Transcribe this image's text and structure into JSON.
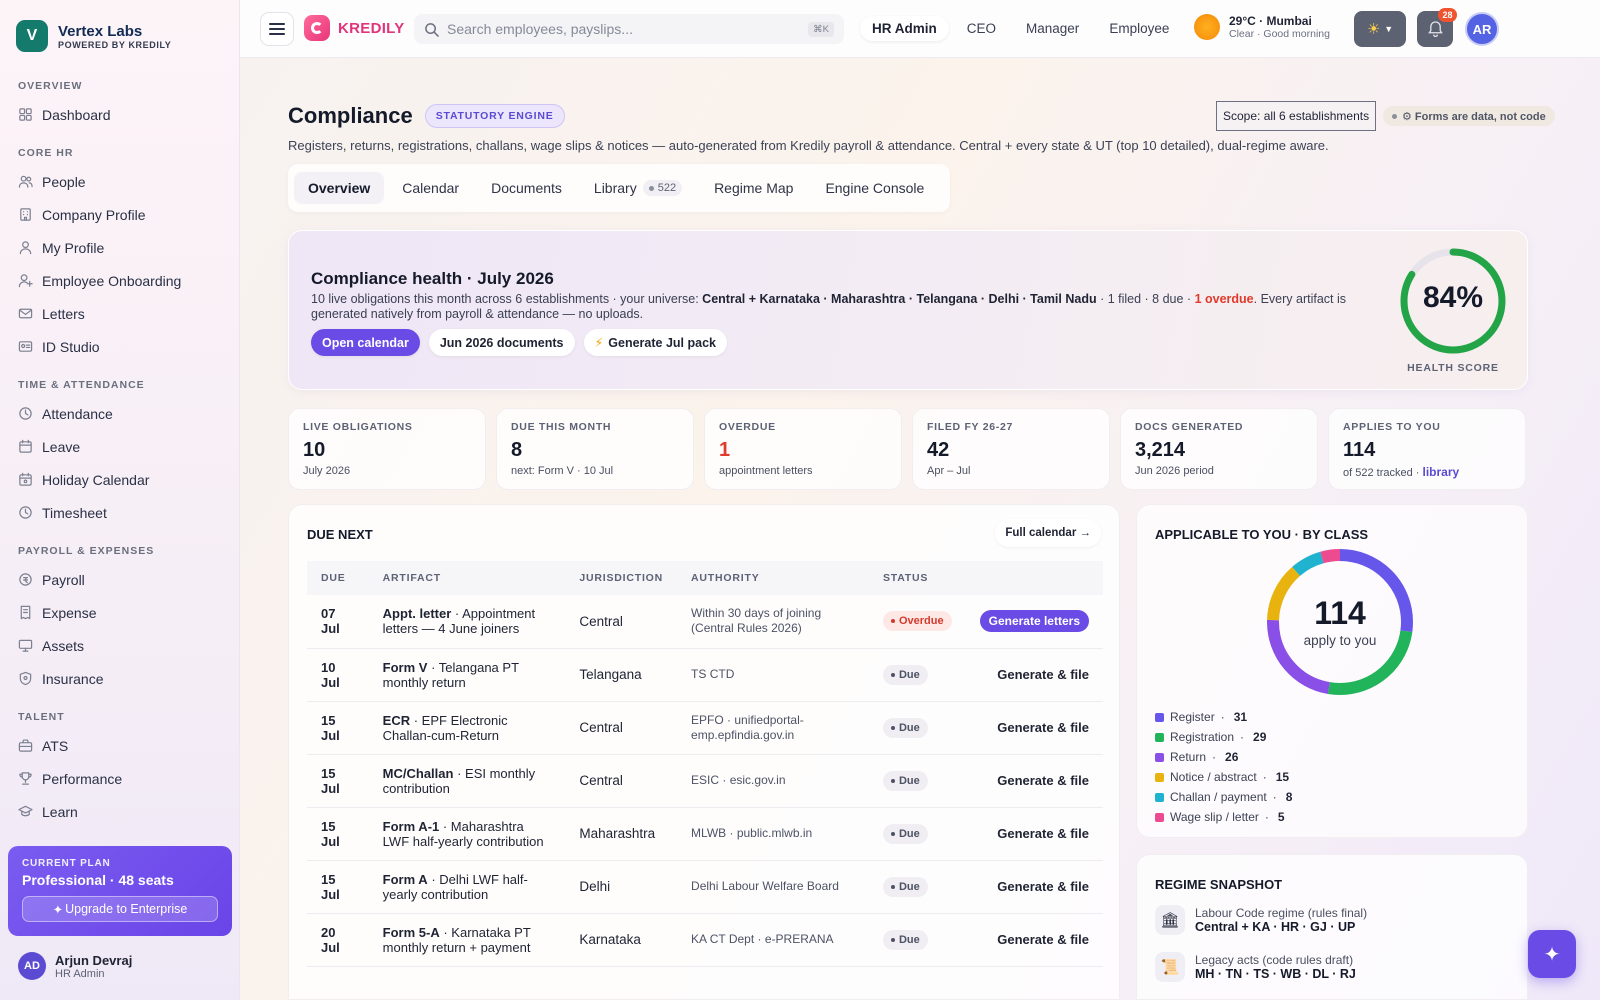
{
  "brand": {
    "name": "Vertex Labs",
    "sub": "POWERED BY KREDILY",
    "logo_letter": "V"
  },
  "sidebar": {
    "groups": [
      {
        "title": "OVERVIEW",
        "items": [
          {
            "label": "Dashboard",
            "icon": "grid-icon"
          }
        ]
      },
      {
        "title": "CORE HR",
        "items": [
          {
            "label": "People",
            "icon": "people-icon"
          },
          {
            "label": "Company Profile",
            "icon": "building-icon"
          },
          {
            "label": "My Profile",
            "icon": "user-icon"
          },
          {
            "label": "Employee Onboarding",
            "icon": "user-plus-icon"
          },
          {
            "label": "Letters",
            "icon": "mail-icon"
          },
          {
            "label": "ID Studio",
            "icon": "id-card-icon"
          }
        ]
      },
      {
        "title": "TIME & ATTENDANCE",
        "items": [
          {
            "label": "Attendance",
            "icon": "clock-icon"
          },
          {
            "label": "Leave",
            "icon": "calendar-icon"
          },
          {
            "label": "Holiday Calendar",
            "icon": "calendar-star-icon"
          },
          {
            "label": "Timesheet",
            "icon": "clock-icon"
          }
        ]
      },
      {
        "title": "PAYROLL & EXPENSES",
        "items": [
          {
            "label": "Payroll",
            "icon": "coin-icon"
          },
          {
            "label": "Expense",
            "icon": "receipt-icon"
          },
          {
            "label": "Assets",
            "icon": "monitor-icon"
          },
          {
            "label": "Insurance",
            "icon": "shield-icon"
          }
        ]
      },
      {
        "title": "TALENT",
        "items": [
          {
            "label": "ATS",
            "icon": "briefcase-icon"
          },
          {
            "label": "Performance",
            "icon": "trophy-icon"
          },
          {
            "label": "Learn",
            "icon": "grad-cap-icon"
          }
        ]
      }
    ],
    "plan": {
      "label": "CURRENT PLAN",
      "name": "Professional · 48 seats",
      "upgrade": "Upgrade to Enterprise"
    },
    "user": {
      "initials": "AD",
      "name": "Arjun Devraj",
      "role": "HR Admin"
    }
  },
  "topbar": {
    "product": "KREDILY",
    "search_placeholder": "Search employees, payslips...",
    "shortcut": "⌘K",
    "roles": [
      "HR Admin",
      "CEO",
      "Manager",
      "Employee"
    ],
    "active_role": "HR Admin",
    "weather": {
      "main": "29°C · Mumbai",
      "sub": "Clear · Good morning"
    },
    "notifications": "28",
    "avatar": "AR"
  },
  "page": {
    "title": "Compliance",
    "badge": "STATUTORY ENGINE",
    "scope": "Scope: all 6 establishments",
    "forms_note": "⚙ Forms are data, not code",
    "subtitle": "Registers, returns, registrations, challans, wage slips & notices — auto-generated from Kredily payroll & attendance. Central + every state & UT (top 10 detailed), dual-regime aware.",
    "tabs": [
      {
        "label": "Overview"
      },
      {
        "label": "Calendar"
      },
      {
        "label": "Documents"
      },
      {
        "label": "Library",
        "count": "522"
      },
      {
        "label": "Regime Map"
      },
      {
        "label": "Engine Console"
      }
    ]
  },
  "health": {
    "title": "Compliance health · July 2026",
    "desc_a": "10 live obligations this month across 6 establishments · your universe: ",
    "desc_b": "Central + Karnataka · Maharashtra · Telangana · Delhi · Tamil Nadu",
    "desc_c": " · 1 filed · 8 due · ",
    "desc_d": "1 overdue",
    "desc_e": ". Every artifact is generated natively from payroll & attendance — no uploads.",
    "actions": [
      "Open calendar",
      "Jun 2026 documents",
      "Generate Jul pack"
    ],
    "score": 84,
    "score_text": "84%",
    "score_label": "HEALTH SCORE",
    "colors": {
      "ring": "#22a447",
      "track": "#e6e3ea"
    }
  },
  "stats": [
    {
      "label": "LIVE OBLIGATIONS",
      "value": "10",
      "sub": "July 2026"
    },
    {
      "label": "DUE THIS MONTH",
      "value": "8",
      "sub": "next: Form V · 10 Jul"
    },
    {
      "label": "OVERDUE",
      "value": "1",
      "sub": "appointment letters"
    },
    {
      "label": "FILED FY 26-27",
      "value": "42",
      "sub": "Apr – Jul"
    },
    {
      "label": "DOCS GENERATED",
      "value": "3,214",
      "sub": "Jun 2026 period"
    },
    {
      "label": "APPLIES TO YOU",
      "value": "114",
      "sub": "of 522 tracked · ",
      "link": "library"
    }
  ],
  "due": {
    "title": "DUE NEXT",
    "full_calendar": "Full calendar →",
    "columns": [
      "DUE",
      "ARTIFACT",
      "JURISDICTION",
      "AUTHORITY",
      "STATUS",
      ""
    ],
    "rows": [
      {
        "due": "07 Jul",
        "form": "Appt. letter",
        "desc": " · Appointment letters — 4 June joiners",
        "jur": "Central",
        "auth": "Within 30 days of joining (Central Rules 2026)",
        "status": "Overdue",
        "action": "Generate letters"
      },
      {
        "due": "10 Jul",
        "form": "Form V",
        "desc": " · Telangana PT monthly return",
        "jur": "Telangana",
        "auth": "TS CTD",
        "status": "Due",
        "action": "Generate & file"
      },
      {
        "due": "15 Jul",
        "form": "ECR",
        "desc": " · EPF Electronic Challan-cum-Return",
        "jur": "Central",
        "auth": "EPFO · unifiedportal-emp.epfindia.gov.in",
        "status": "Due",
        "action": "Generate & file"
      },
      {
        "due": "15 Jul",
        "form": "MC/Challan",
        "desc": " · ESI monthly contribution",
        "jur": "Central",
        "auth": "ESIC · esic.gov.in",
        "status": "Due",
        "action": "Generate & file"
      },
      {
        "due": "15 Jul",
        "form": "Form A-1",
        "desc": " · Maharashtra LWF half-yearly contribution",
        "jur": "Maharashtra",
        "auth": "MLWB · public.mlwb.in",
        "status": "Due",
        "action": "Generate & file"
      },
      {
        "due": "15 Jul",
        "form": "Form A",
        "desc": " · Delhi LWF half-yearly contribution",
        "jur": "Delhi",
        "auth": "Delhi Labour Welfare Board",
        "status": "Due",
        "action": "Generate & file"
      },
      {
        "due": "20 Jul",
        "form": "Form 5-A",
        "desc": " · Karnataka PT monthly return + payment",
        "jur": "Karnataka",
        "auth": "KA CT Dept · e-PRERANA",
        "status": "Due",
        "action": "Generate & file"
      }
    ]
  },
  "by_class": {
    "title": "APPLICABLE TO YOU · BY CLASS",
    "total": "114",
    "total_sub": "apply to you",
    "classes": [
      {
        "name": "Register",
        "count": 31,
        "color": "#6656ea"
      },
      {
        "name": "Registration",
        "count": 29,
        "color": "#22b45a"
      },
      {
        "name": "Return",
        "count": 26,
        "color": "#8a4fe6"
      },
      {
        "name": "Notice / abstract",
        "count": 15,
        "color": "#e9b30f"
      },
      {
        "name": "Challan / payment",
        "count": 8,
        "color": "#1fb3d0"
      },
      {
        "name": "Wage slip / letter",
        "count": 5,
        "color": "#ec4b8f"
      }
    ]
  },
  "regime": {
    "title": "REGIME SNAPSHOT",
    "rows": [
      {
        "icon": "🏛",
        "l1": "Labour Code regime (rules final)",
        "l2": "Central + KA · HR · GJ · UP"
      },
      {
        "icon": "📜",
        "l1": "Legacy acts (code rules draft)",
        "l2": "MH · TN · TS · WB · DL · RJ"
      }
    ]
  },
  "fab": "✦"
}
